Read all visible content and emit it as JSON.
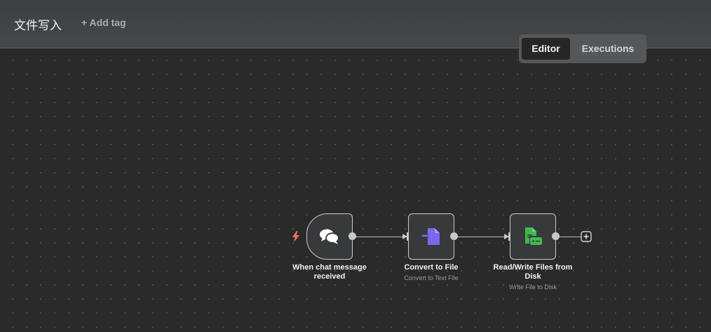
{
  "header": {
    "workflow_name": "文件写入",
    "add_tag_label": "+ Add tag"
  },
  "tabs": {
    "editor": "Editor",
    "executions": "Executions",
    "active": "Editor"
  },
  "nodes": [
    {
      "label": "When chat message received",
      "subtitle": "",
      "icon": "chat-bubbles-icon",
      "type": "trigger"
    },
    {
      "label": "Convert to File",
      "subtitle": "Convert to Text File",
      "icon": "convert-file-icon",
      "type": "action"
    },
    {
      "label": "Read/Write Files from Disk",
      "subtitle": "Write File to Disk",
      "icon": "disk-file-icon",
      "type": "action"
    }
  ],
  "colors": {
    "canvas_bg": "#2a2a2a",
    "trigger_bolt": "#ff6f5c",
    "convert_icon": "#7b68ee",
    "disk_icon": "#3fb950"
  }
}
